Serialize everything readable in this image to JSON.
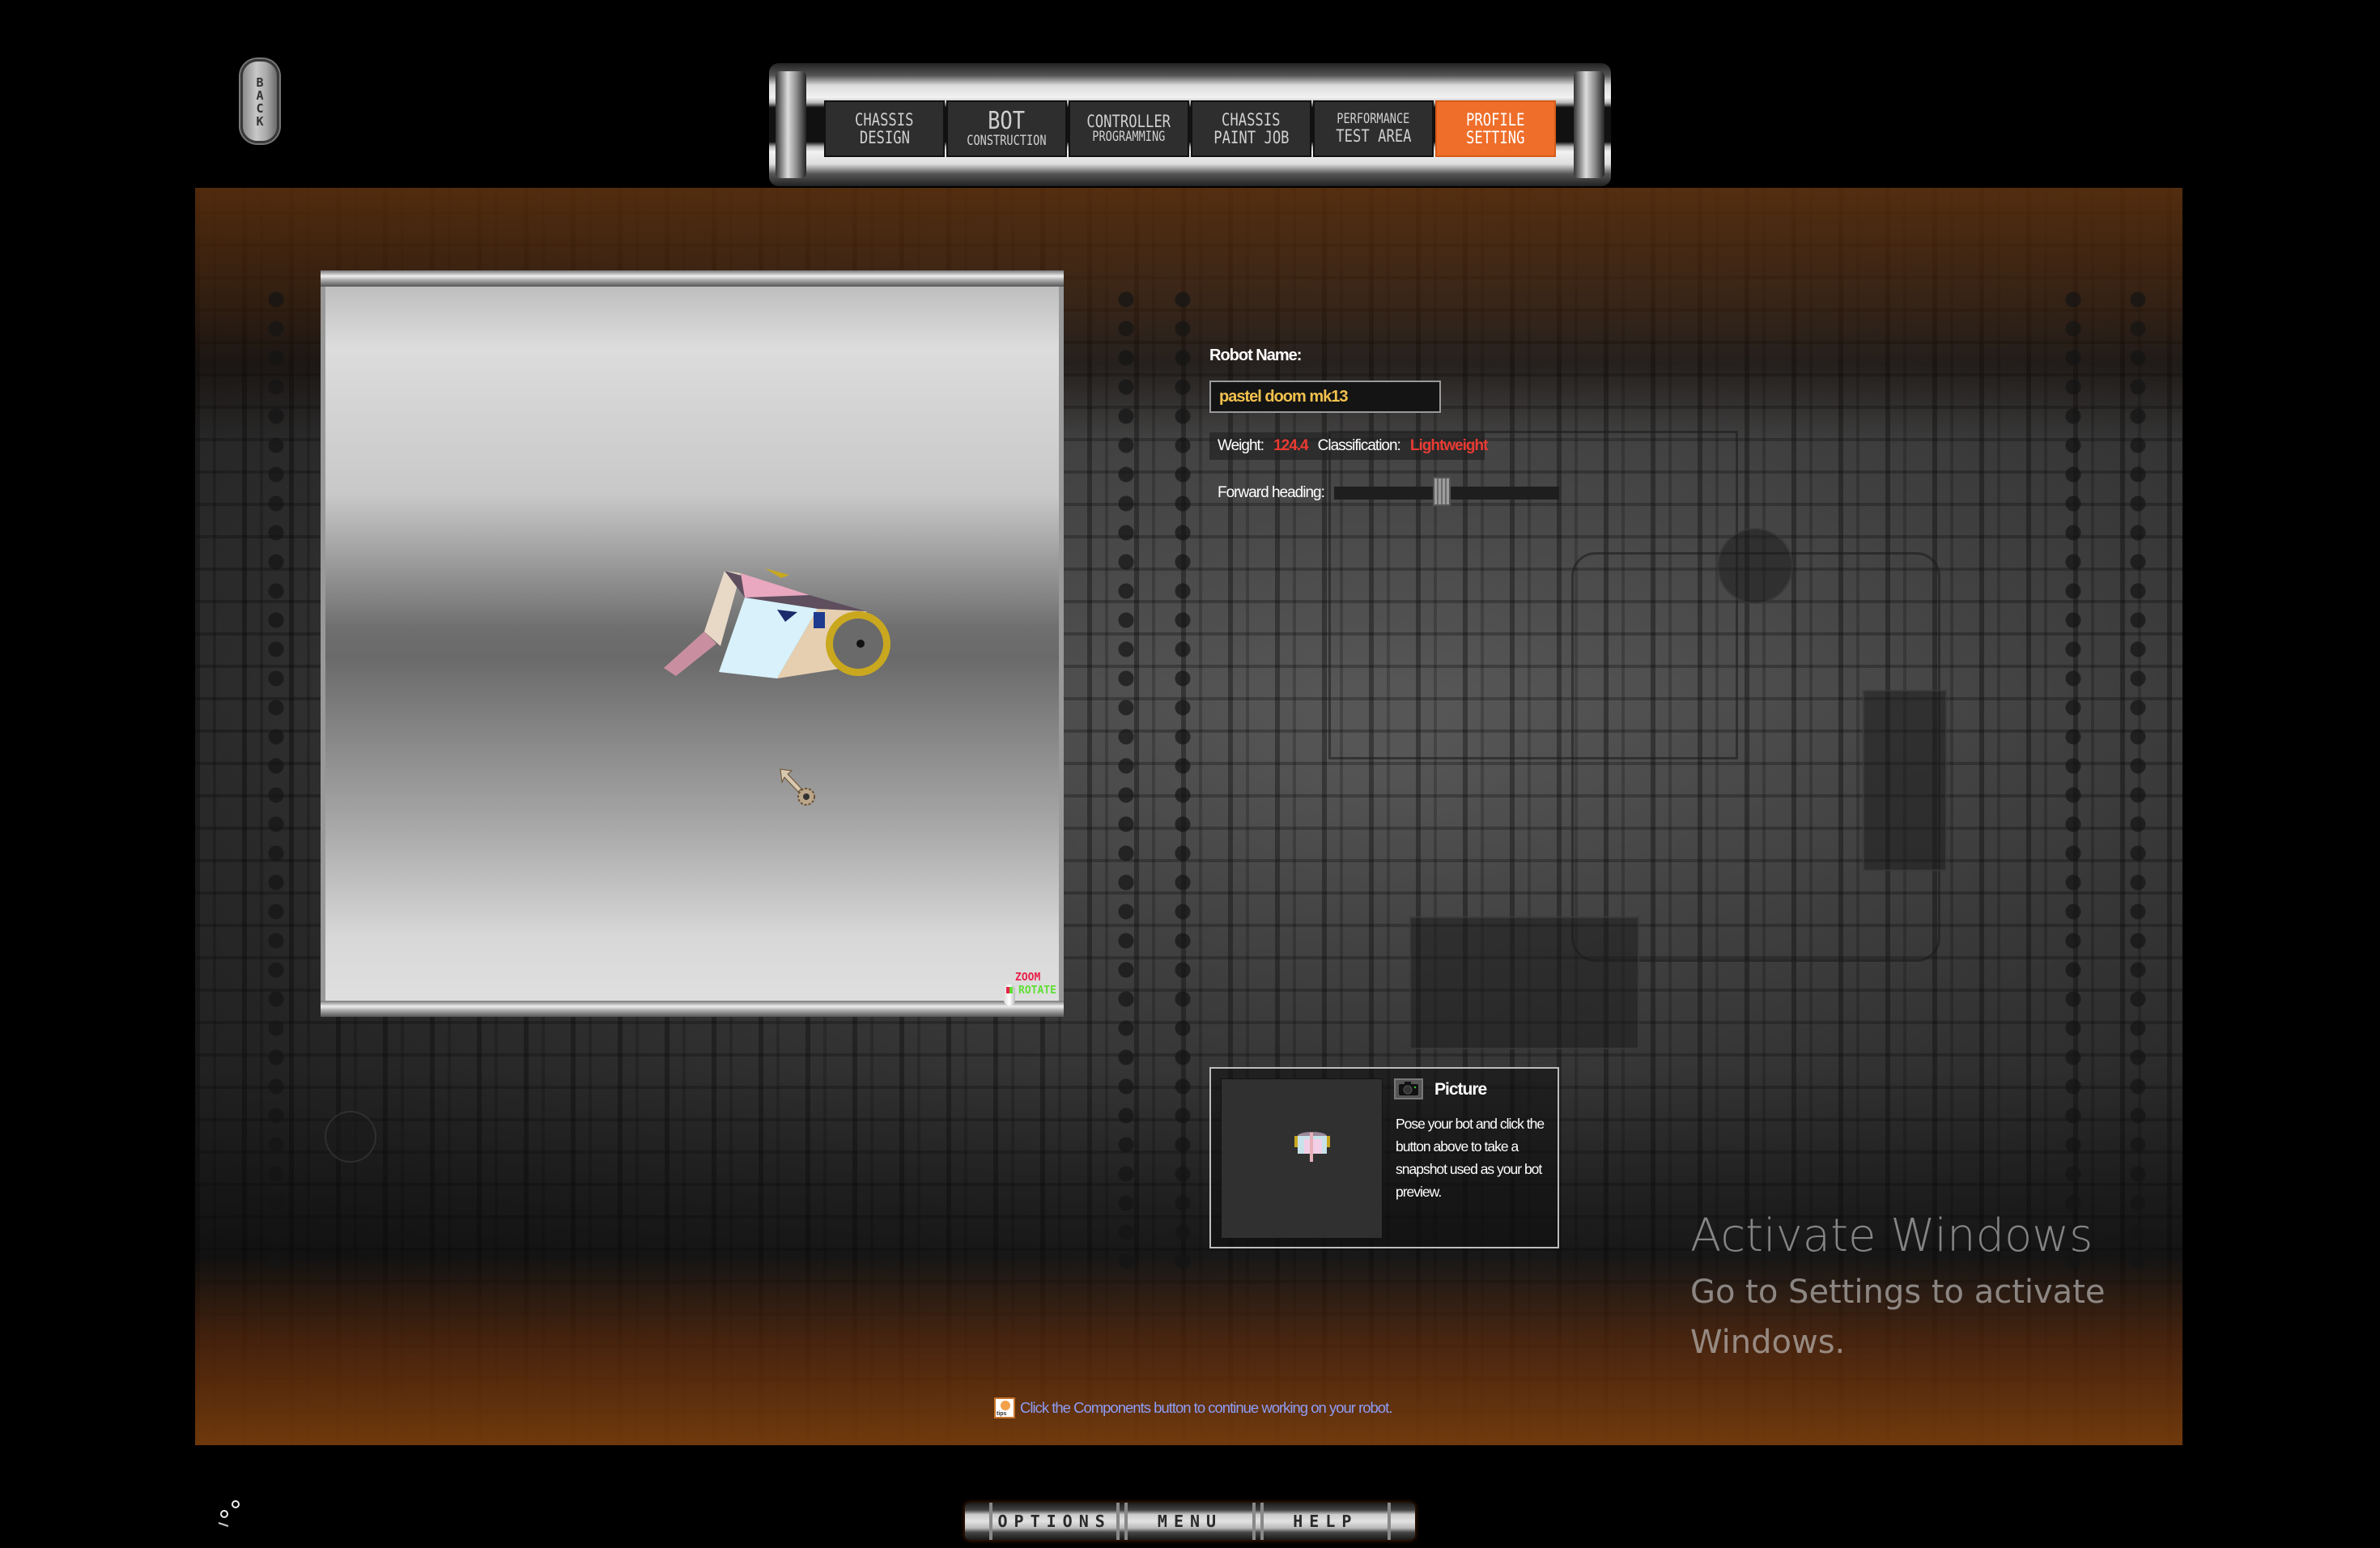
{
  "back_button": {
    "label": "BACK"
  },
  "top_nav": {
    "tabs": [
      {
        "line1": "CHASSIS",
        "line2": "DESIGN",
        "active": false
      },
      {
        "line1": "BOT",
        "line2": "CONSTRUCTION",
        "active": false
      },
      {
        "line1": "CONTROLLER",
        "line2": "PROGRAMMING",
        "active": false
      },
      {
        "line1": "CHASSIS",
        "line2": "PAINT JOB",
        "active": false
      },
      {
        "line1": "PERFORMANCE",
        "line2": "TEST AREA",
        "active": false
      },
      {
        "line1": "PROFILE",
        "line2": "SETTING",
        "active": true
      }
    ],
    "active_color": "#ee6e2a"
  },
  "viewport": {
    "hint_zoom": "ZOOM",
    "hint_rotate": "ROTATE"
  },
  "profile": {
    "robot_name_label": "Robot Name:",
    "robot_name_value": "pastel doom mk13",
    "weight_label": "Weight:",
    "weight_value": "124.4",
    "classification_label": "Classification:",
    "classification_value": "Lightweight",
    "forward_heading_label": "Forward heading:",
    "forward_heading_value": 0.48,
    "value_color": "#ea3b33",
    "name_color": "#f2c14e"
  },
  "picture_panel": {
    "title": "Picture",
    "description": "Pose your bot and click the button above to take a snapshot used as your bot preview."
  },
  "tip": {
    "icon_label": "tips",
    "text": "Click the Components button to continue working on your robot."
  },
  "bottom_menu": {
    "buttons": [
      "OPTIONS",
      "MENU",
      "HELP"
    ]
  },
  "watermark": {
    "title": "Activate Windows",
    "subtitle": "Go to Settings to activate Windows."
  }
}
